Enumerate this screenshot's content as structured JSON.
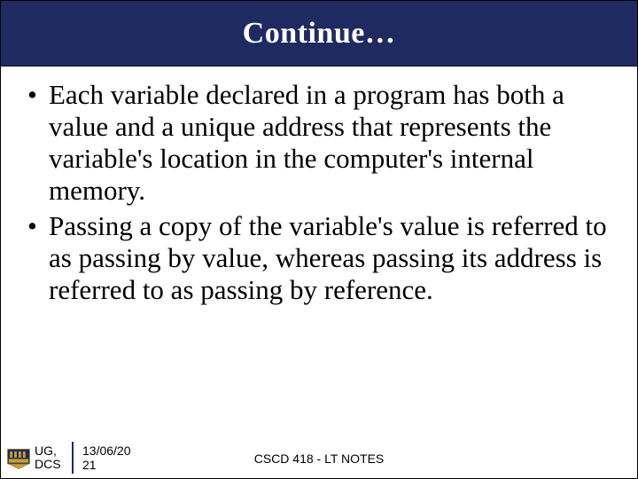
{
  "title": "Continue…",
  "bullets": [
    "Each variable declared in a program has both a value and a unique address that represents the variable's location in the computer's internal memory.",
    "Passing a copy of the variable's value is referred to as passing by value, whereas passing its address is referred to as passing by reference."
  ],
  "footer": {
    "org_line1": "UG,",
    "org_line2": "DCS",
    "date_line1": "13/06/20",
    "date_line2": "21",
    "course": "CSCD 418 - LT NOTES"
  },
  "colors": {
    "banner": "#1f2a60",
    "logo_gold": "#c9a227"
  }
}
